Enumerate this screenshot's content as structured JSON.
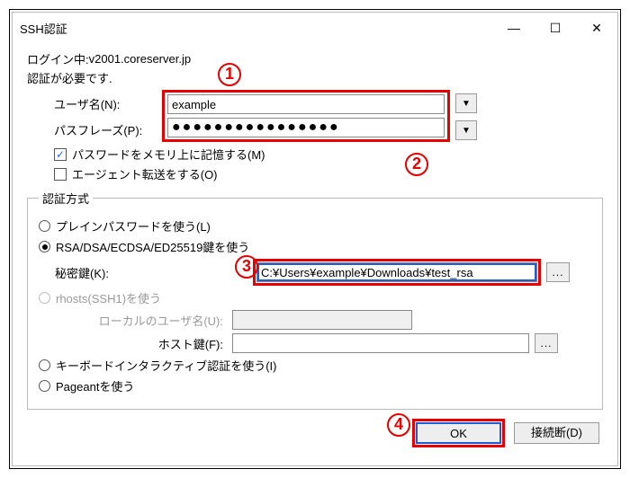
{
  "window": {
    "title": "SSH認証"
  },
  "status": {
    "login_prefix": "ログイン中: ",
    "host": "v2001.coreserver.jp",
    "auth_required": "認証が必要です."
  },
  "fields": {
    "username_label": "ユーザ名(N):",
    "username_value": "example",
    "passphrase_label": "パスフレーズ(P):",
    "passphrase_mask": "●●●●●●●●●●●●●●●●"
  },
  "checkboxes": {
    "remember_pw": "パスワードをメモリ上に記憶する(M)",
    "agent_fwd": "エージェント転送をする(O)"
  },
  "auth": {
    "legend": "認証方式",
    "plain": "プレインパスワードを使う(L)",
    "rsa": "RSA/DSA/ECDSA/ED25519鍵を使う",
    "privkey_label": "秘密鍵(K):",
    "privkey_value": "C:¥Users¥example¥Downloads¥test_rsa",
    "rhosts": "rhosts(SSH1)を使う",
    "local_user_label": "ローカルのユーザ名(U):",
    "hostkey_label": "ホスト鍵(F):",
    "kbint": "キーボードインタラクティブ認証を使う(I)",
    "pageant": "Pageantを使う"
  },
  "buttons": {
    "ok": "OK",
    "disconnect": "接続断(D)",
    "browse": "..."
  },
  "annotations": {
    "a1": "1",
    "a2": "2",
    "a3": "3",
    "a4": "4"
  },
  "icons": {
    "dropdown": "▼",
    "check": "✓",
    "minimize": "—",
    "maximize": "☐",
    "close": "✕"
  }
}
